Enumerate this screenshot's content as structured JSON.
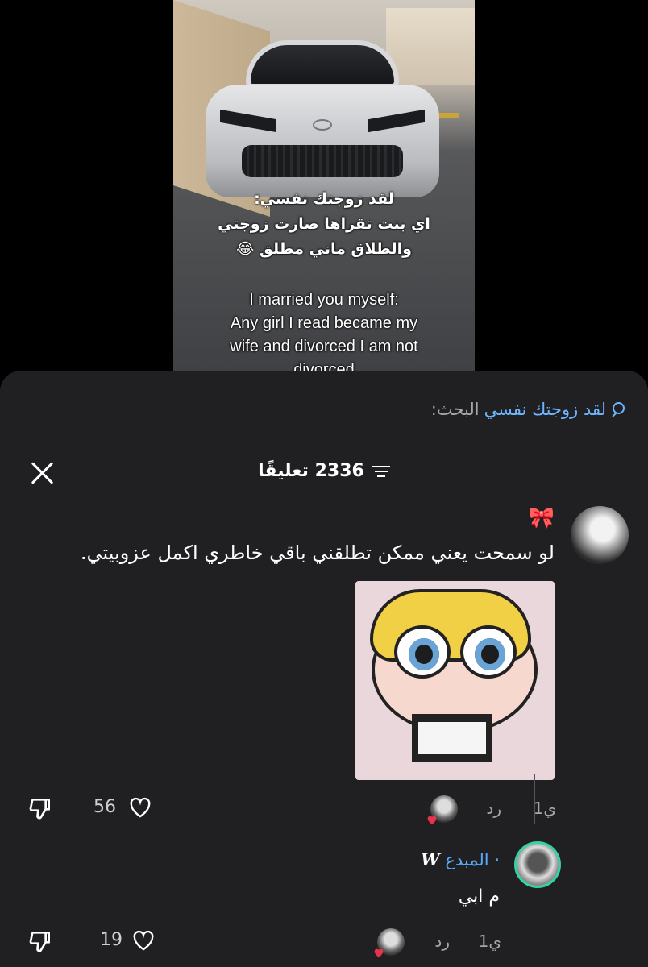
{
  "video": {
    "caption_ar": [
      "لقد زوجتك نفسي:",
      "اي بنت تقراها صارت زوجتي",
      "والطلاق ماني مطلق 😂"
    ],
    "caption_en": [
      "I married you myself:",
      "Any girl I read became my",
      "wife and divorced I am not",
      "divorced"
    ]
  },
  "search": {
    "prefix": "البحث:",
    "term": "لقد زوجتك نفسي"
  },
  "comments_header": {
    "count_text": "2336 تعليقًا"
  },
  "comment": {
    "username": "🎀",
    "text": "لو سمحت يعني ممكن تطلقني باقي خاطري اكمل عزوبيتي.",
    "time": "1ي",
    "reply_label": "رد",
    "likes": "56"
  },
  "reply": {
    "name_prefix": "𝑾",
    "name": "· المبدع",
    "text": "م ابي",
    "time": "1ي",
    "reply_label": "رد",
    "likes": "19"
  },
  "colors": {
    "link": "#6fb6ff",
    "sheet": "#202023",
    "accent_ring": "#32d3a5",
    "heart": "#e8344a"
  }
}
